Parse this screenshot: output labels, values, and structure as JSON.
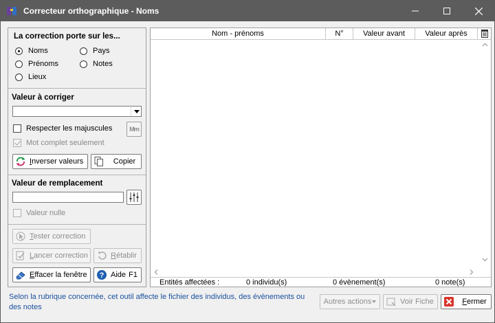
{
  "window": {
    "title": "Correcteur orthographique - Noms"
  },
  "scope": {
    "title": "La correction porte sur les...",
    "options": [
      {
        "label": "Noms",
        "selected": true
      },
      {
        "label": "Pays",
        "selected": false
      },
      {
        "label": "Prénoms",
        "selected": false
      },
      {
        "label": "Notes",
        "selected": false
      },
      {
        "label": "Lieux",
        "selected": false
      }
    ]
  },
  "correct": {
    "title": "Valeur à corriger",
    "value": "",
    "respect_case_label": "Respecter les majuscules",
    "whole_word_label": "Mot complet seulement",
    "case_icon_text": "Mm",
    "invert_label_u": "I",
    "invert_label_rest": "nverser valeurs",
    "copy_label": "Copier"
  },
  "replace": {
    "title": "Valeur de remplacement",
    "value": "",
    "null_label": "Valeur nulle"
  },
  "actions": {
    "test_u": "T",
    "test_rest": "ester correction",
    "launch_u": "L",
    "launch_rest": "ancer correction",
    "restore_u": "R",
    "restore_rest": "établir",
    "clear_u": "E",
    "clear_rest": "ffacer la fenêtre",
    "help_label": "Aide",
    "help_key": "F1"
  },
  "table": {
    "columns": [
      "Nom - prénoms",
      "N°",
      "Valeur avant",
      "Valeur après"
    ],
    "rows": []
  },
  "status": {
    "label": "Entités affectées :",
    "individuals": "0 individu(s)",
    "events": "0  évènement(s)",
    "notes": "0  note(s)"
  },
  "footer": {
    "info": "Selon la rubrique concernée, cet outil affecte le fichier des individus, des évènements ou des notes",
    "more_label": "Autres actions",
    "view_label": "Voir Fiche",
    "close_u": "F",
    "close_rest": "ermer"
  },
  "colors": {
    "titlebar": "#5c5c5c",
    "info_text": "#1a4f9c",
    "accent_red": "#d9342b"
  }
}
